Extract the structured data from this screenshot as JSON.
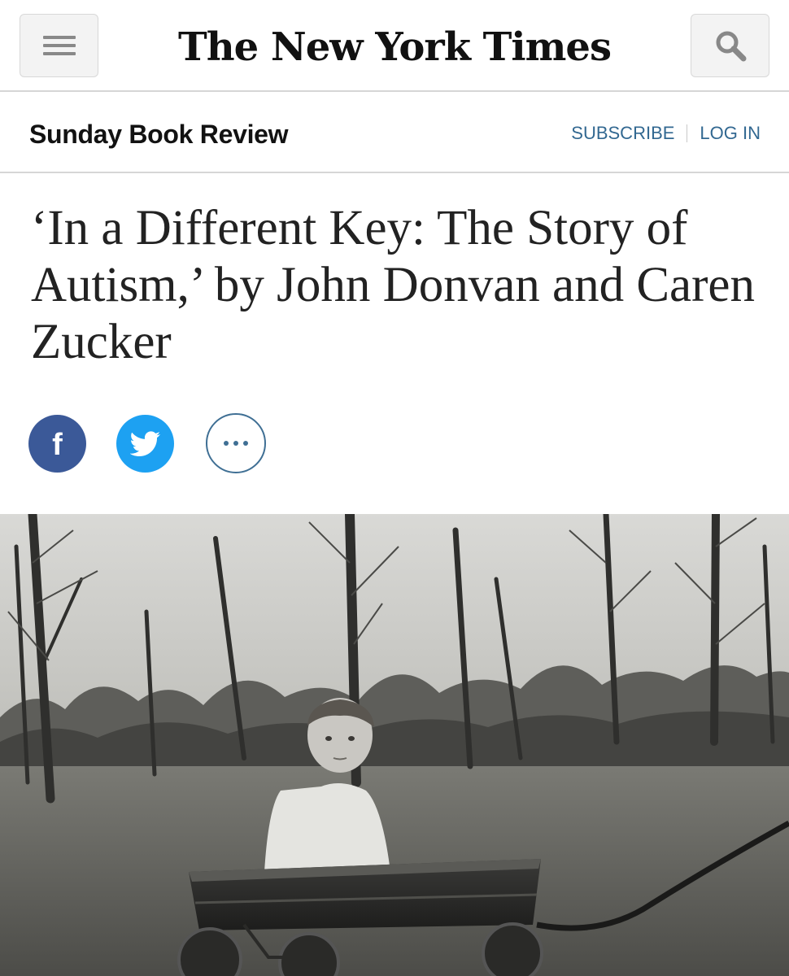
{
  "header": {
    "logo_text": "The New York Times",
    "menu_icon": "hamburger-menu-icon",
    "search_icon": "magnifier-search-icon"
  },
  "section": {
    "title": "Sunday Book Review",
    "subscribe_label": "SUBSCRIBE",
    "login_label": "LOG IN"
  },
  "article": {
    "headline": "‘In a Different Key: The Story of Autism,’ by John Donvan and Caren Zucker"
  },
  "share": {
    "facebook_label": "f",
    "facebook_icon": "facebook-icon",
    "twitter_icon": "twitter-bird-icon",
    "more_icon": "more-options-icon"
  },
  "colors": {
    "link_blue": "#326891",
    "facebook_blue": "#3b5998",
    "twitter_blue": "#1da1f2",
    "divider": "#d6d6d6"
  }
}
